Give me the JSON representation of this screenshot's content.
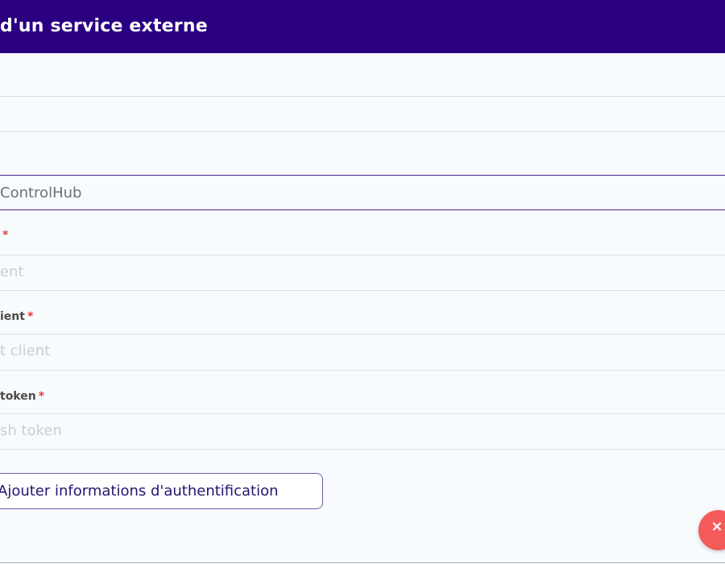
{
  "header": {
    "title": "d'un service externe"
  },
  "fields": {
    "controlhub_value": "ControlHub",
    "field2_required": "*",
    "field2_placeholder": "ent",
    "field3_label": "ient",
    "field3_required": "*",
    "field3_placeholder": "t client",
    "field4_label": "token",
    "field4_required": "*",
    "field4_placeholder": "sh token"
  },
  "actions": {
    "add_auth_label": "Ajouter informations d'authentification",
    "close_symbol": "×"
  },
  "colors": {
    "header_bg": "#2a0081",
    "close_bg": "#f55a5a",
    "required": "#e53935"
  }
}
